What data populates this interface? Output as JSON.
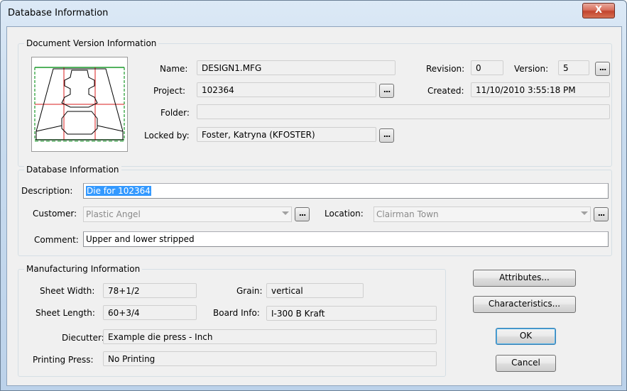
{
  "window": {
    "title": "Database Information",
    "close_glyph": "X"
  },
  "document_version": {
    "group_label": "Document Version Information",
    "name_label": "Name:",
    "name_value": "DESIGN1.MFG",
    "project_label": "Project:",
    "project_value": "102364",
    "folder_label": "Folder:",
    "folder_value": "",
    "locked_label": "Locked by:",
    "locked_value": "Foster, Katryna (KFOSTER)",
    "revision_label": "Revision:",
    "revision_value": "0",
    "version_label": "Version:",
    "version_value": "5",
    "created_label": "Created:",
    "created_value": "11/10/2010 3:55:18 PM",
    "ellipsis": "..."
  },
  "database_info": {
    "group_label": "Database Information",
    "description_label": "Description:",
    "description_value": "Die for 102364",
    "customer_label": "Customer:",
    "customer_value": "Plastic Angel",
    "location_label": "Location:",
    "location_value": "Clairman Town",
    "comment_label": "Comment:",
    "comment_value": "Upper and lower stripped"
  },
  "manufacturing": {
    "group_label": "Manufacturing Information",
    "sheet_width_label": "Sheet Width:",
    "sheet_width_value": "78+1/2",
    "sheet_length_label": "Sheet Length:",
    "sheet_length_value": "60+3/4",
    "grain_label": "Grain:",
    "grain_value": "vertical",
    "board_label": "Board Info:",
    "board_value": "I-300 B Kraft",
    "diecutter_label": "Diecutter:",
    "diecutter_value": "Example die press - Inch",
    "printing_label": "Printing Press:",
    "printing_value": "No Printing"
  },
  "buttons": {
    "attributes": "Attributes...",
    "characteristics": "Characteristics...",
    "ok": "OK",
    "cancel": "Cancel"
  },
  "colors": {
    "selection": "#3399ff",
    "drawing_red": "#d81c1c",
    "drawing_green": "#1a9a2a"
  }
}
